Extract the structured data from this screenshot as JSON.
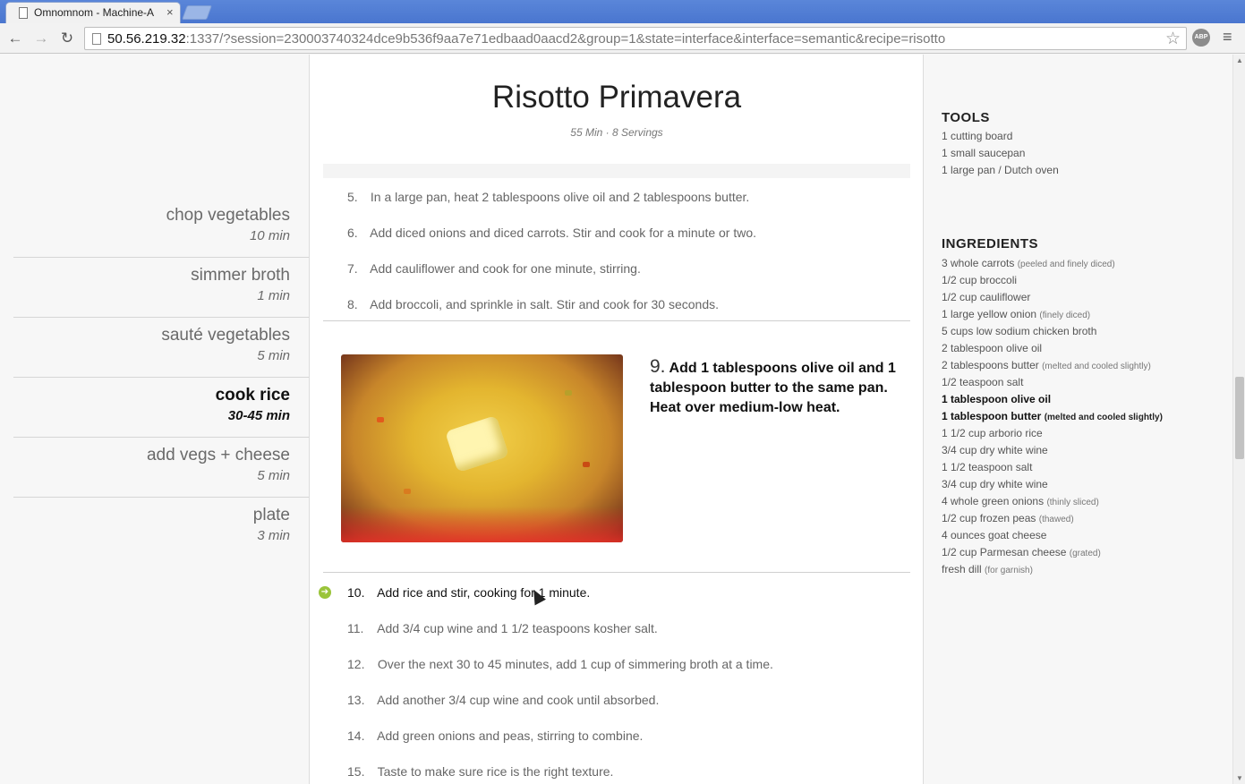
{
  "browser": {
    "tab_title": "Omnomnom - Machine-A",
    "tab_close": "×",
    "url_host": "50.56.219.32",
    "url_rest": ":1337/?session=230003740324dce9b536f9aa7e71edbaad0aacd2&group=1&state=interface&interface=semantic&recipe=risotto",
    "back": "←",
    "forward": "→",
    "reload": "↻",
    "star": "☆",
    "abp": "ABP",
    "menu": "≡"
  },
  "phases": [
    {
      "name": "chop vegetables",
      "time": "10 min"
    },
    {
      "name": "simmer broth",
      "time": "1 min"
    },
    {
      "name": "sauté vegetables",
      "time": "5 min"
    },
    {
      "name": "cook rice",
      "time": "30-45 min"
    },
    {
      "name": "add vegs + cheese",
      "time": "5 min"
    },
    {
      "name": "plate",
      "time": "3 min"
    }
  ],
  "recipe": {
    "title": "Risotto Primavera",
    "meta": "55 Min · 8 Servings"
  },
  "steps_before": [
    {
      "num": "5.",
      "text": "In a large pan, heat 2 tablespoons olive oil and 2 tablespoons butter."
    },
    {
      "num": "6.",
      "text": "Add diced onions and diced carrots. Stir and cook for a minute or two."
    },
    {
      "num": "7.",
      "text": "Add cauliflower and cook for one minute, stirring."
    },
    {
      "num": "8.",
      "text": "Add broccoli, and sprinkle in salt. Stir and cook for 30 seconds."
    }
  ],
  "focus_step": {
    "num": "9.",
    "text": "Add 1 tablespoons olive oil and 1 tablespoon butter to the same pan. Heat over medium-low heat."
  },
  "steps_after": [
    {
      "num": "10.",
      "text": "Add rice and stir, cooking for 1 minute."
    },
    {
      "num": "11.",
      "text": "Add 3/4 cup wine and 1 1/2 teaspoons kosher salt."
    },
    {
      "num": "12.",
      "text": "Over the next 30 to 45 minutes, add 1 cup of simmering broth at a time."
    },
    {
      "num": "13.",
      "text": "Add another 3/4 cup wine and cook until absorbed."
    },
    {
      "num": "14.",
      "text": "Add green onions and peas, stirring to combine."
    },
    {
      "num": "15.",
      "text": "Taste to make sure rice is the right texture."
    }
  ],
  "go_icon": "➔",
  "tools": {
    "heading": "TOOLS",
    "items": [
      "1 cutting board",
      "1 small saucepan",
      "1 large pan / Dutch oven"
    ]
  },
  "ingredients": {
    "heading": "INGREDIENTS",
    "items": [
      {
        "text": "3 whole carrots",
        "note": "(peeled and finely diced)"
      },
      {
        "text": "1/2 cup broccoli",
        "note": ""
      },
      {
        "text": "1/2 cup cauliflower",
        "note": ""
      },
      {
        "text": "1 large yellow onion",
        "note": "(finely diced)"
      },
      {
        "text": "5 cups low sodium chicken broth",
        "note": ""
      },
      {
        "text": "2 tablespoon olive oil",
        "note": ""
      },
      {
        "text": "2 tablespoons butter",
        "note": "(melted and cooled slightly)"
      },
      {
        "text": "1/2 teaspoon salt",
        "note": ""
      },
      {
        "text": "1 tablespoon olive oil",
        "note": ""
      },
      {
        "text": "1 tablespoon butter",
        "note": "(melted and cooled slightly)"
      },
      {
        "text": "1 1/2 cup arborio rice",
        "note": ""
      },
      {
        "text": "3/4 cup dry white wine",
        "note": ""
      },
      {
        "text": "1 1/2 teaspoon salt",
        "note": ""
      },
      {
        "text": "3/4 cup dry white wine",
        "note": ""
      },
      {
        "text": "4 whole green onions",
        "note": "(thinly sliced)"
      },
      {
        "text": "1/2 cup frozen peas",
        "note": "(thawed)"
      },
      {
        "text": "4 ounces goat cheese",
        "note": ""
      },
      {
        "text": "1/2 cup Parmesan cheese",
        "note": "(grated)"
      },
      {
        "text": "fresh dill",
        "note": "(for garnish)"
      }
    ]
  }
}
